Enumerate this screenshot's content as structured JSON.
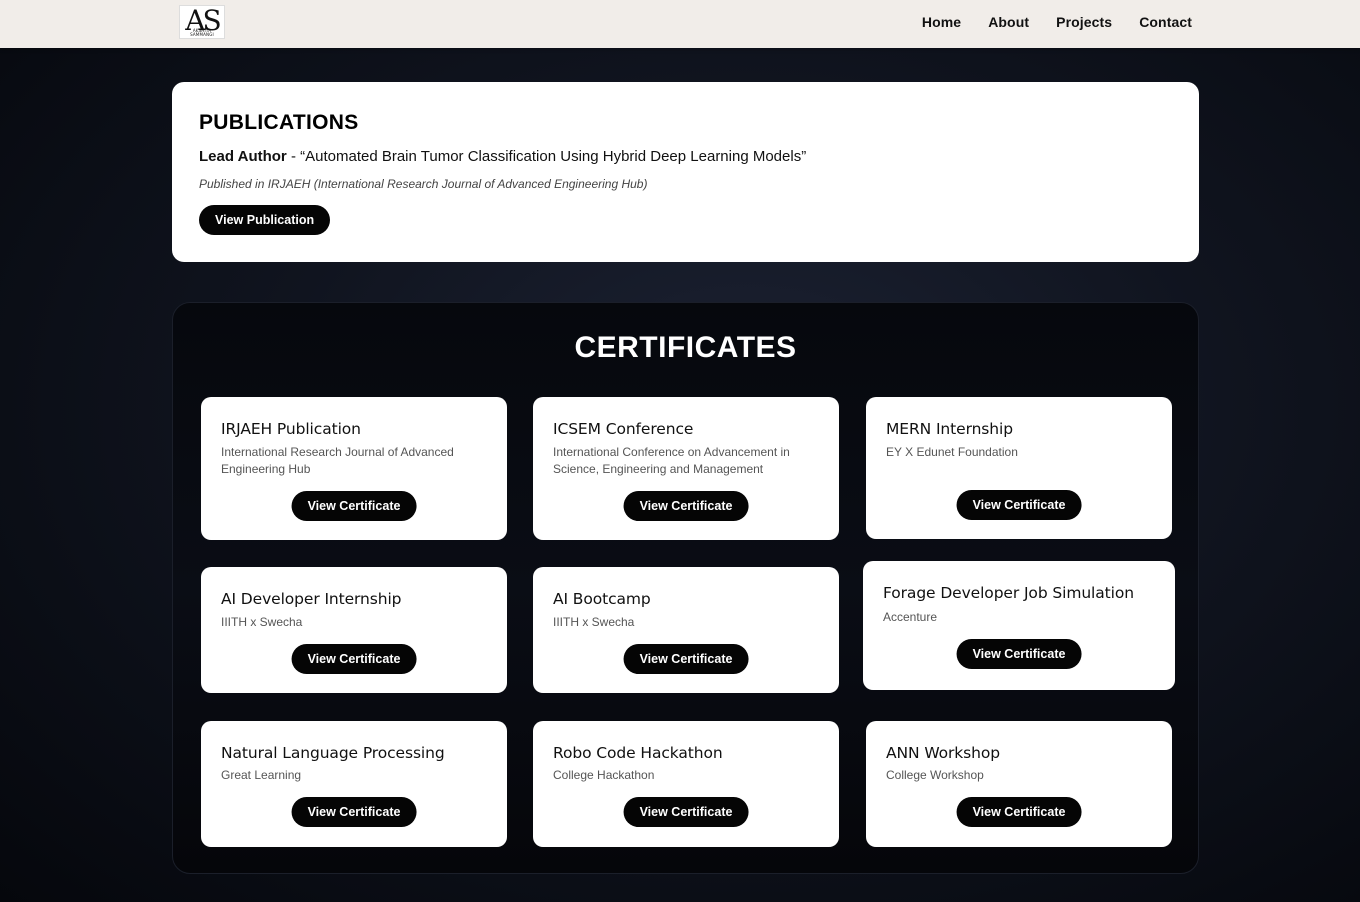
{
  "nav": {
    "logo_letters": "AS",
    "logo_subtext": "AKSHITA SAMMANGI",
    "links": [
      "Home",
      "About",
      "Projects",
      "Contact"
    ]
  },
  "publications": {
    "heading": "PUBLICATIONS",
    "role": "Lead Author",
    "separator": " - ",
    "title": "“Automated Brain Tumor Classification Using Hybrid Deep Learning Models”",
    "published_in": "Published in IRJAEH (International Research Journal of Advanced Engineering Hub)",
    "button_label": "View Publication"
  },
  "certificates": {
    "heading": "CERTIFICATES",
    "items": [
      {
        "title": "IRJAEH Publication",
        "desc": "International Research Journal of Advanced Engineering Hub",
        "button": "View Certificate"
      },
      {
        "title": "ICSEM Conference",
        "desc": "International Conference on Advancement in Science, Engineering and Management",
        "button": "View Certificate"
      },
      {
        "title": "MERN Internship",
        "desc": "EY X Edunet Foundation",
        "button": "View Certificate"
      },
      {
        "title": "AI Developer Internship",
        "desc": "IIITH x Swecha",
        "button": "View Certificate"
      },
      {
        "title": "AI Bootcamp",
        "desc": "IIITH x Swecha",
        "button": "View Certificate"
      },
      {
        "title": "Forage Developer Job Simulation",
        "desc": "Accenture",
        "button": "View Certificate"
      },
      {
        "title": "Natural Language Processing",
        "desc": "Great Learning",
        "button": "View Certificate"
      },
      {
        "title": "Robo Code Hackathon",
        "desc": "College Hackathon",
        "button": "View Certificate"
      },
      {
        "title": "ANN Workshop",
        "desc": "College Workshop",
        "button": "View Certificate"
      }
    ]
  }
}
